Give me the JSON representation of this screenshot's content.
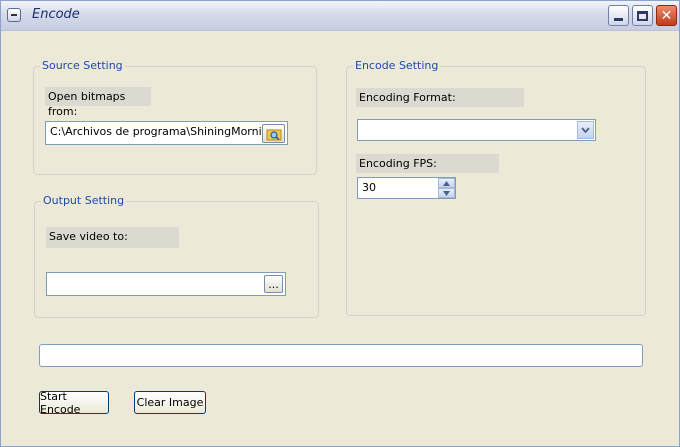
{
  "window": {
    "title": "Encode"
  },
  "source": {
    "legend": "Source Setting",
    "label": "Open bitmaps from:",
    "path_value": "C:\\Archivos de programa\\ShiningMorning'"
  },
  "output": {
    "legend": "Output Setting",
    "label": "Save video to:",
    "path_value": "",
    "browse_label": "..."
  },
  "encode": {
    "legend": "Encode Setting",
    "format_label": "Encoding Format:",
    "format_value": "",
    "fps_label": "Encoding FPS:",
    "fps_value": "30"
  },
  "progress": {
    "value": 0
  },
  "buttons": {
    "start": "Start Encode",
    "clear": "Clear Image"
  },
  "icons": {
    "window": "app-icon",
    "browse_source": "folder-search-icon",
    "combo": "chevron-down-icon"
  }
}
